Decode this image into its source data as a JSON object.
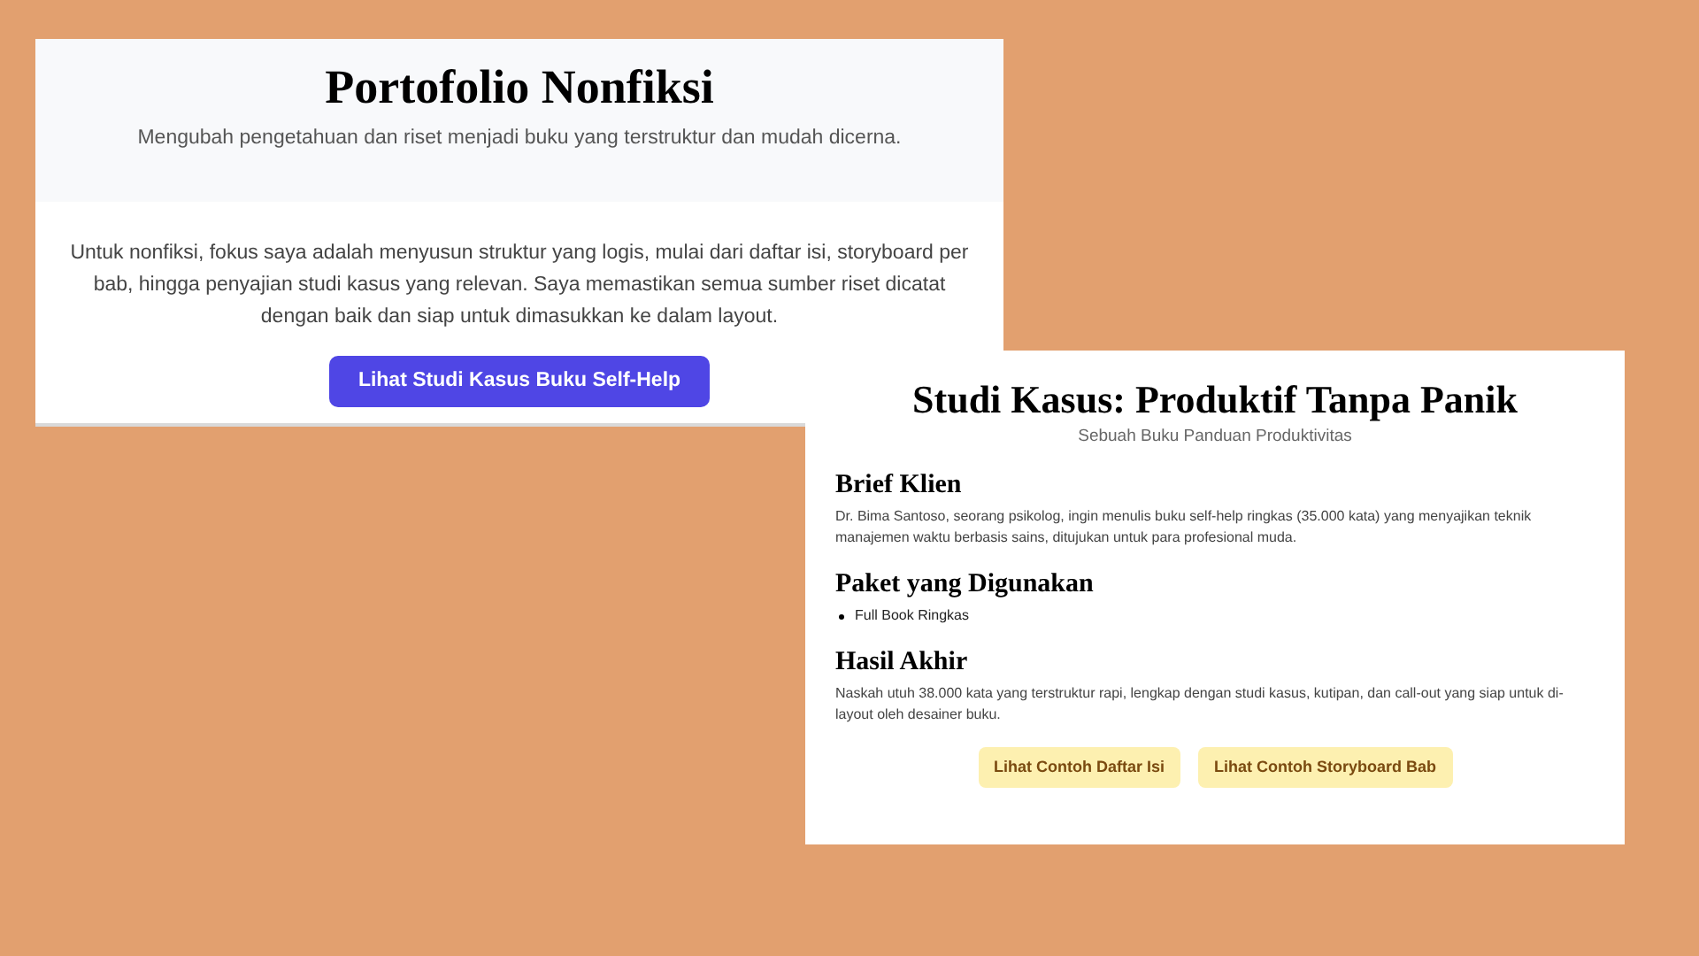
{
  "portfolio": {
    "title": "Portofolio Nonfiksi",
    "subtitle": "Mengubah pengetahuan dan riset menjadi buku yang terstruktur dan mudah dicerna.",
    "body": "Untuk nonfiksi, fokus saya adalah menyusun struktur yang logis, mulai dari daftar isi, storyboard per bab, hingga penyajian studi kasus yang relevan. Saya memastikan semua sumber riset dicatat dengan baik dan siap untuk dimasukkan ke dalam layout.",
    "button": "Lihat Studi Kasus Buku Self-Help"
  },
  "case_study": {
    "title": "Studi Kasus: Produktif Tanpa Panik",
    "subtitle": "Sebuah Buku Panduan Produktivitas",
    "sections": [
      {
        "kind": "paragraph",
        "heading": "Brief Klien",
        "text": "Dr. Bima Santoso, seorang psikolog, ingin menulis buku self-help ringkas (35.000 kata) yang menyajikan teknik manajemen waktu berbasis sains, ditujukan untuk para profesional muda."
      },
      {
        "kind": "list",
        "heading": "Paket yang Digunakan",
        "items": [
          "Full Book Ringkas"
        ]
      },
      {
        "kind": "paragraph",
        "heading": "Hasil Akhir",
        "text": "Naskah utuh 38.000 kata yang terstruktur rapi, lengkap dengan studi kasus, kutipan, dan call-out yang siap untuk di-layout oleh desainer buku."
      }
    ],
    "buttons": [
      "Lihat Contoh Daftar Isi",
      "Lihat Contoh Storyboard Bab"
    ]
  }
}
